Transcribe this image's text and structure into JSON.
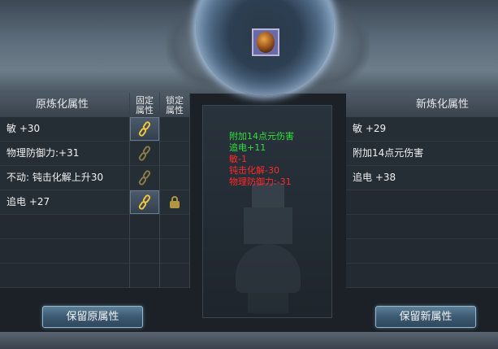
{
  "colors": {
    "positive": "#2fe03a",
    "negative": "#ff2a2a",
    "chain_gold": "#f0c53c"
  },
  "item": {
    "icon": "amulet-icon"
  },
  "left_panel": {
    "title": "原炼化属性",
    "col_fixed": [
      "固定",
      "属性"
    ],
    "col_lock": [
      "锁定",
      "属性"
    ],
    "rows": [
      {
        "text": "敏 +30",
        "fixed_icon": "chain-icon",
        "fixed": true,
        "locked": false
      },
      {
        "text": "物理防御力:+31",
        "fixed_icon": "chain-icon",
        "fixed": false,
        "locked": false
      },
      {
        "text": "不动: 钝击化解上升30",
        "fixed_icon": "chain-icon",
        "fixed": false,
        "locked": false
      },
      {
        "text": "追电 +27",
        "fixed_icon": "chain-icon",
        "fixed": true,
        "locked": true
      }
    ]
  },
  "center_panel": {
    "changes": [
      {
        "text": "附加14点元伤害",
        "type": "positive"
      },
      {
        "text": "追电+11",
        "type": "positive"
      },
      {
        "text": "敏-1",
        "type": "negative"
      },
      {
        "text": "钝击化解-30",
        "type": "negative"
      },
      {
        "text": "物理防御力:-31",
        "type": "negative"
      }
    ]
  },
  "right_panel": {
    "title": "新炼化属性",
    "rows": [
      {
        "text": "敏 +29"
      },
      {
        "text": "附加14点元伤害"
      },
      {
        "text": "追电 +38"
      }
    ]
  },
  "buttons": {
    "keep_original": "保留原属性",
    "keep_new": "保留新属性"
  }
}
